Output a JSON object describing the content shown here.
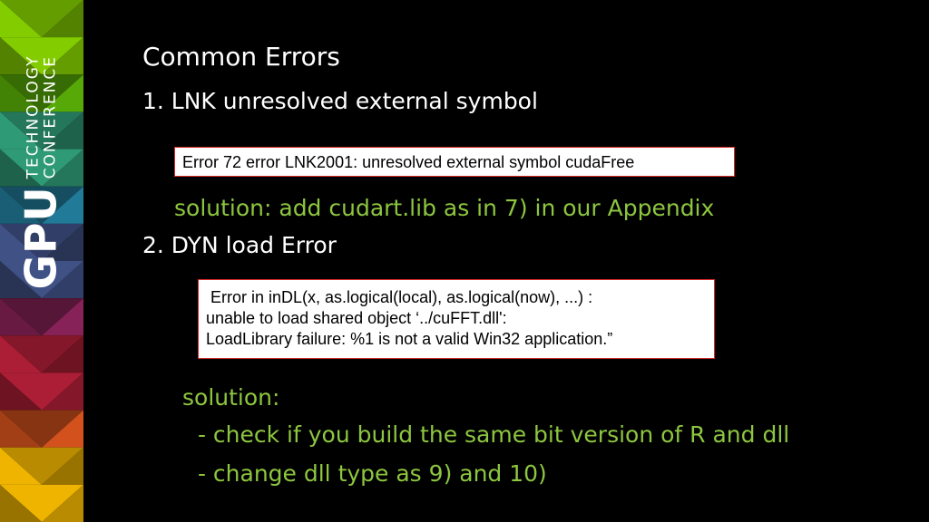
{
  "brand": {
    "gpu": "GPU",
    "line1": "TECHNOLOGY",
    "line2": "CONFERENCE"
  },
  "slide": {
    "title": "Common Errors",
    "item1": "1. LNK unresolved external symbol",
    "error1": "Error 72  error LNK2001: unresolved external symbol cudaFree",
    "solution1": "solution: add cudart.lib as in 7) in our Appendix",
    "item2": "2. DYN load Error",
    "error2": [
      " Error in inDL(x, as.logical(local), as.logical(now), ...) :",
      "unable to load shared object ‘../cuFFT.dll':",
      "LoadLibrary failure: %1 is not a valid Win32 application.”"
    ],
    "solution2_label": "solution:",
    "solution2_lines": [
      " - check if you build the same bit version of R and dll",
      " - change dll type as 9) and 10)"
    ]
  },
  "colors": {
    "background": "#000000",
    "text": "#ffffff",
    "accent_green": "#8dc63f",
    "error_border": "#d92a2a",
    "sidebar_palette": [
      "#76b900",
      "#4e9a06",
      "#2b8c6b",
      "#1f6f8b",
      "#3a4a7a",
      "#7a1f4f",
      "#9b1b30",
      "#c04a1a",
      "#d9a400"
    ]
  }
}
